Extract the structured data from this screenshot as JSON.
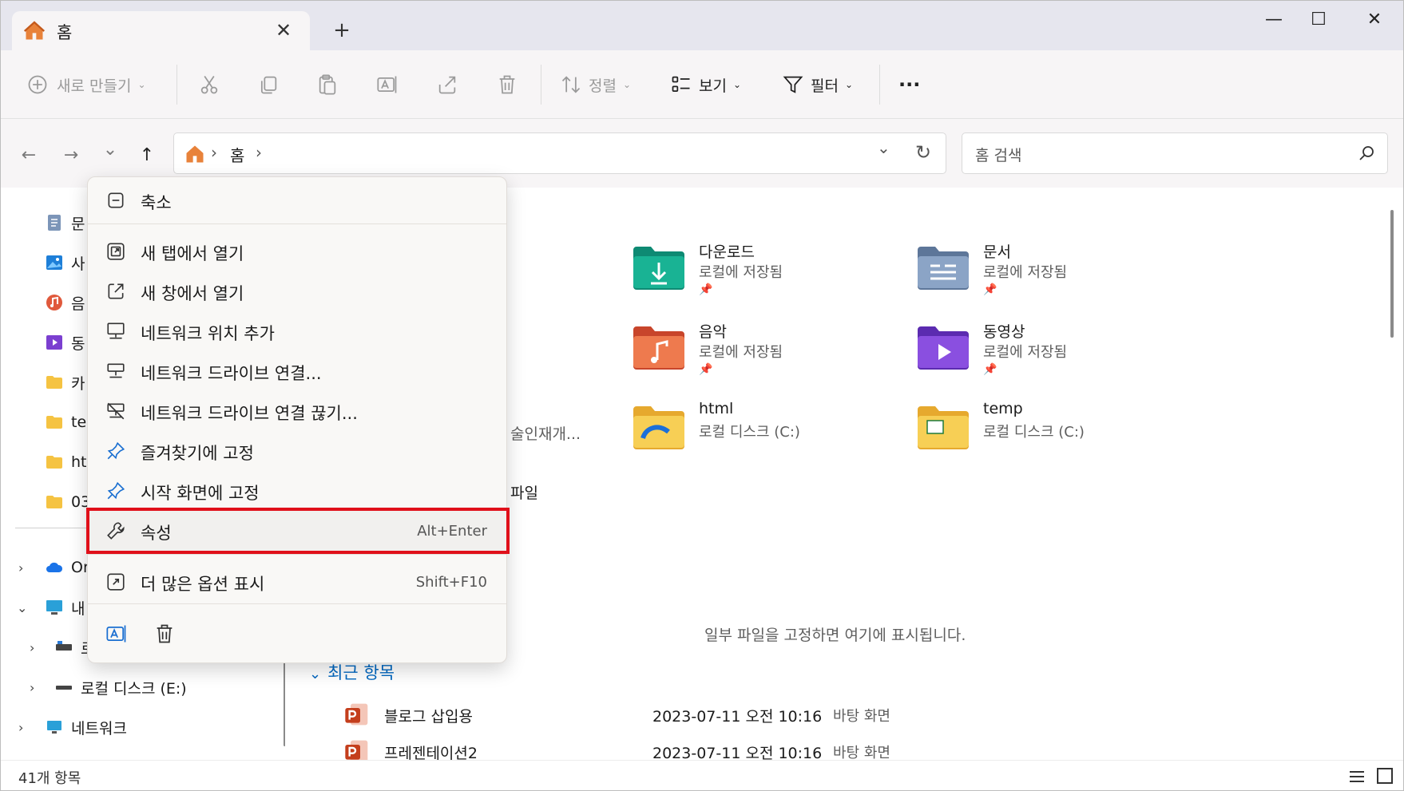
{
  "tab": {
    "title": "홈",
    "close": "✕"
  },
  "newtab": "+",
  "window_controls": {
    "minimize": "—",
    "maximize": "☐",
    "close": "✕"
  },
  "toolbar": {
    "new_label": "새로 만들기",
    "sort_label": "정렬",
    "view_label": "보기",
    "filter_label": "필터",
    "more": "···"
  },
  "nav": {
    "back": "←",
    "forward": "→",
    "recent": "⌄",
    "up": "↑"
  },
  "address": {
    "crumb1": "홈",
    "sep": "›",
    "dropdown": "⌄",
    "refresh": "↻"
  },
  "search": {
    "placeholder": "홈 검색"
  },
  "sidebar": {
    "items": [
      {
        "label": "문"
      },
      {
        "label": "사"
      },
      {
        "label": "음"
      },
      {
        "label": "동"
      },
      {
        "label": "카"
      },
      {
        "label": "ter"
      },
      {
        "label": "ht"
      },
      {
        "label": "03"
      }
    ],
    "onedrive": "Or",
    "thispc": "내",
    "drive1": "로",
    "drive_e": "로컬 디스크 (E:)",
    "network": "네트워크"
  },
  "folders": [
    {
      "name": "다운로드",
      "sub": "로컬에 저장됨"
    },
    {
      "name": "문서",
      "sub": "로컬에 저장됨"
    },
    {
      "name": "음악",
      "sub": "로컬에 저장됨"
    },
    {
      "name": "동영상",
      "sub": "로컬에 저장됨"
    },
    {
      "name": "html",
      "sub": "로컬 디스크 (C:)"
    },
    {
      "name": "temp",
      "sub": "로컬 디스크 (C:)"
    }
  ],
  "partial_texts": {
    "t1": "술인재개...",
    "t2": "파일"
  },
  "pinned_hint": "일부 파일을 고정하면 여기에 표시됩니다.",
  "recent": {
    "header": "최근 항목",
    "rows": [
      {
        "name": "블로그 삽입용",
        "date": "2023-07-11 오전 10:16",
        "location": "바탕 화면"
      },
      {
        "name": "프레젠테이션2",
        "date": "2023-07-11 오전 10:16",
        "location": "바탕 화면"
      }
    ]
  },
  "status": {
    "count": "41개 항목"
  },
  "context_menu": {
    "collapse": "축소",
    "open_new_tab": "새 탭에서 열기",
    "open_new_window": "새 창에서 열기",
    "add_network_location": "네트워크 위치 추가",
    "map_network_drive": "네트워크 드라이브 연결...",
    "disconnect_network_drive": "네트워크 드라이브 연결 끊기...",
    "pin_quick_access": "즐겨찾기에 고정",
    "pin_start": "시작 화면에 고정",
    "properties": "속성",
    "properties_shortcut": "Alt+Enter",
    "more_options": "더 많은 옵션 표시",
    "more_options_shortcut": "Shift+F10"
  },
  "colors": {
    "accent": "#0067c0",
    "highlight": "#e0101a"
  }
}
